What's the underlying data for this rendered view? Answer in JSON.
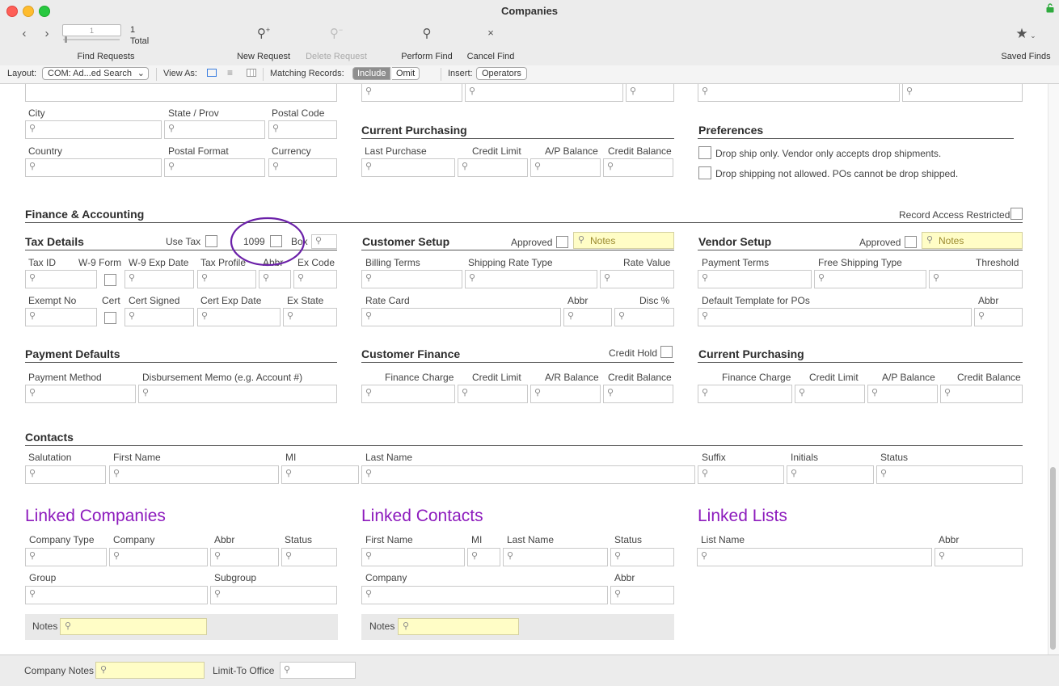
{
  "window": {
    "title": "Companies"
  },
  "toolbar": {
    "record_input": "1",
    "record_count": "1",
    "total_label": "Total",
    "find_requests_label": "Find Requests",
    "new_request_label": "New Request",
    "delete_request_label": "Delete Request",
    "perform_find_label": "Perform Find",
    "cancel_find_label": "Cancel Find",
    "saved_finds_label": "Saved Finds"
  },
  "layoutbar": {
    "layout_label": "Layout:",
    "layout_value": "COM: Ad...ed Search",
    "view_as_label": "View As:",
    "matching_label": "Matching Records:",
    "include_label": "Include",
    "omit_label": "Omit",
    "insert_label": "Insert:",
    "operators_label": "Operators"
  },
  "address": {
    "city": "City",
    "state": "State / Prov",
    "postal_code": "Postal Code",
    "country": "Country",
    "postal_format": "Postal Format",
    "currency": "Currency"
  },
  "vendor_purchasing": {
    "title": "Current Purchasing",
    "last_purchase": "Last Purchase",
    "credit_limit": "Credit Limit",
    "ap_balance": "A/P Balance",
    "credit_balance": "Credit Balance"
  },
  "preferences": {
    "title": "Preferences",
    "drop_ship_only": "Drop ship only. Vendor only accepts drop shipments.",
    "drop_ship_not_allowed": "Drop shipping not allowed. POs cannot be drop shipped."
  },
  "finance": {
    "title": "Finance & Accounting",
    "record_access_restricted": "Record Access Restricted"
  },
  "tax": {
    "title": "Tax Details",
    "use_tax": "Use Tax",
    "n1099": "1099",
    "box": "Box",
    "tax_id": "Tax ID",
    "w9_form": "W-9 Form",
    "w9_exp": "W-9 Exp Date",
    "tax_profile": "Tax Profile",
    "abbr": "Abbr",
    "ex_code": "Ex Code",
    "exempt_no": "Exempt No",
    "cert": "Cert",
    "cert_signed": "Cert Signed",
    "cert_exp": "Cert Exp Date",
    "ex_state": "Ex State"
  },
  "customer_setup": {
    "title": "Customer Setup",
    "approved": "Approved",
    "notes": "Notes",
    "billing_terms": "Billing Terms",
    "shipping_rate_type": "Shipping Rate Type",
    "rate_value": "Rate Value",
    "rate_card": "Rate Card",
    "abbr": "Abbr",
    "disc": "Disc %"
  },
  "vendor_setup": {
    "title": "Vendor Setup",
    "approved": "Approved",
    "notes": "Notes",
    "payment_terms": "Payment Terms",
    "free_shipping_type": "Free Shipping Type",
    "threshold": "Threshold",
    "default_template": "Default Template for POs",
    "abbr": "Abbr"
  },
  "payment_defaults": {
    "title": "Payment Defaults",
    "payment_method": "Payment Method",
    "disbursement_memo": "Disbursement Memo (e.g. Account #)"
  },
  "customer_finance": {
    "title": "Customer Finance",
    "credit_hold": "Credit Hold",
    "finance_charge": "Finance Charge",
    "credit_limit": "Credit Limit",
    "ar_balance": "A/R Balance",
    "credit_balance": "Credit Balance"
  },
  "current_purchasing2": {
    "title": "Current Purchasing",
    "finance_charge": "Finance Charge",
    "credit_limit": "Credit Limit",
    "ap_balance": "A/P Balance",
    "credit_balance": "Credit Balance"
  },
  "contacts": {
    "title": "Contacts",
    "salutation": "Salutation",
    "first_name": "First Name",
    "mi": "MI",
    "last_name": "Last Name",
    "suffix": "Suffix",
    "initials": "Initials",
    "status": "Status"
  },
  "linked_companies": {
    "title": "Linked Companies",
    "company_type": "Company Type",
    "company": "Company",
    "abbr": "Abbr",
    "status": "Status",
    "group": "Group",
    "subgroup": "Subgroup",
    "notes": "Notes"
  },
  "linked_contacts": {
    "title": "Linked Contacts",
    "first_name": "First Name",
    "mi": "MI",
    "last_name": "Last Name",
    "status": "Status",
    "company": "Company",
    "abbr": "Abbr",
    "notes": "Notes"
  },
  "linked_lists": {
    "title": "Linked Lists",
    "list_name": "List Name",
    "abbr": "Abbr"
  },
  "footer": {
    "company_notes": "Company Notes",
    "limit_to_office": "Limit-To Office"
  },
  "colors": {
    "accent_purple": "#8d1bbd",
    "highlight_yellow": "#fffdc6",
    "annotation_circle": "#6a1fa8"
  }
}
